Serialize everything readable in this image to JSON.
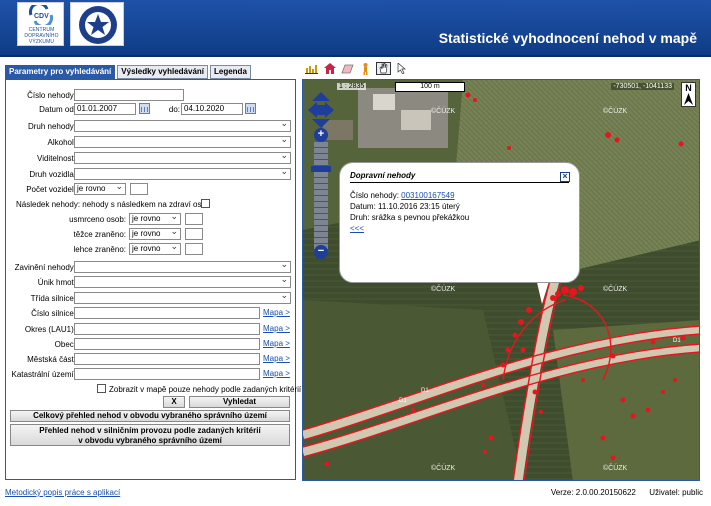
{
  "header": {
    "title": "Statistické vyhodnocení nehod v mapě",
    "cdv_logo_lines": [
      "CENTRUM",
      "DOPRAVNÍHO",
      "VÝZKUMU"
    ],
    "police_logo_text": "POLICIE ČESKÉ REPUBLIKY"
  },
  "tabs": [
    {
      "label": "Parametry pro vyhledávání",
      "active": true
    },
    {
      "label": "Výsledky vyhledávání",
      "active": false
    },
    {
      "label": "Legenda",
      "active": false
    }
  ],
  "form": {
    "cislo_nehody_label": "Číslo nehody:",
    "datum_od_label": "Datum od:",
    "datum_od_value": "01.01.2007",
    "do_label": "do:",
    "datum_do_value": "04.10.2020",
    "druh_nehody_label": "Druh nehody:",
    "alkohol_label": "Alkohol:",
    "viditelnost_label": "Viditelnost:",
    "druh_vozidla_label": "Druh vozidla:",
    "pocet_vozidel_label": "Počet vozidel:",
    "pocet_vozidel_op": "je rovno",
    "nasledek_label": "Následek nehody:",
    "nasledek_text": "nehody s následkem na zdraví osob",
    "usmrceno_label": "usmrceno osob:",
    "tezce_label": "těžce zraněno:",
    "lehce_label": "lehce zraněno:",
    "op_value": "je rovno",
    "zavineni_label": "Zavinění nehody:",
    "unik_label": "Únik hmot:",
    "trida_label": "Třída silnice:",
    "cislo_silnice_label": "Číslo silnice:",
    "okres_label": "Okres (LAU1):",
    "obec_label": "Obec:",
    "mestska_cast_label": "Městská část:",
    "katastralni_label": "Katastrální území:",
    "mapa_link": "Mapa >",
    "zobrazit_label": "Zobrazit v mapě pouze nehody podle zadaných kritérií",
    "x_button": "X",
    "vyhledat_button": "Vyhledat",
    "celkovy_button": "Celkový přehled nehod v obvodu vybraného správního území",
    "prehled_button_line1": "Přehled nehod v silničním provozu podle zadaných kritérií",
    "prehled_button_line2": "v obvodu vybraného správního území"
  },
  "map": {
    "scale_label": "1 : 2835",
    "scale_bar_label": "100 m",
    "coords": "-730501, -1041133",
    "north_label": "N",
    "watermark": "©ČÚZK",
    "road_labels": [
      "D1",
      "D1",
      "D1"
    ],
    "popup": {
      "title": "Dopravní nehody",
      "cislo_label": "Číslo nehody:",
      "cislo_value": "003100167549",
      "datum_label": "Datum:",
      "datum_value": "11.10.2016 23:15 úterý",
      "druh_label": "Druh:",
      "druh_value": "srážka s pevnou překážkou",
      "back_link": "<<<"
    }
  },
  "footer": {
    "link": "Metodický popis práce s aplikací",
    "version": "Verze: 2.0.00.20150622",
    "user": "Uživatel: public"
  },
  "colors": {
    "header_blue": "#1e52a8",
    "accident_red": "#e8151e",
    "link_blue": "#1a4fb0"
  }
}
